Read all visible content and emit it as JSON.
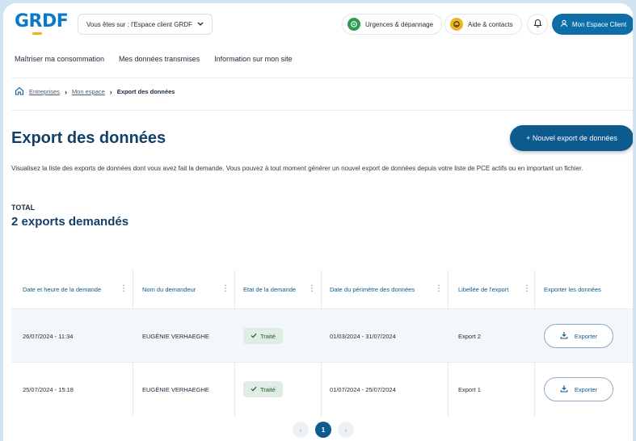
{
  "header": {
    "logo_text": "GRDF",
    "space_selector": "Vous êtes sur : l'Espace client GRDF",
    "urgences": "Urgences & dépannage",
    "aide": "Aide & contacts",
    "account": "Mon Espace Client"
  },
  "nav": {
    "items": [
      "Maîtriser ma consommation",
      "Mes données transmises",
      "Information sur mon site"
    ]
  },
  "breadcrumb": {
    "items": [
      "Entreprises",
      "Mon espace"
    ],
    "current": "Export des données"
  },
  "page": {
    "title": "Export des données",
    "new_button": "+ Nouvel export de données",
    "description": "Visualisez la liste des exports de données dont vous avez fait la demande. Vous pouvez à tout moment générer un nouvel export de données depuis votre liste de PCE actifs ou en important un fichier.",
    "total_label": "TOTAL",
    "total_value": "2 exports demandés"
  },
  "table": {
    "columns": [
      "Date et heure de la demande",
      "Nom du demandeur",
      "Etat de la demande",
      "Date du périmètre des données",
      "Libellée de l'export",
      "Exporter les données"
    ],
    "rows": [
      {
        "datetime": "26/07/2024 - 11:34",
        "name": "EUGÉNIE VERHAEGHE",
        "status": "Traité",
        "period": "01/03/2024 - 31/07/2024",
        "label": "Export 2",
        "action": "Exporter"
      },
      {
        "datetime": "25/07/2024 - 15:18",
        "name": "EUGÉNIE VERHAEGHE",
        "status": "Traité",
        "period": "01/07/2024 - 25/07/2024",
        "label": "Export 1",
        "action": "Exporter"
      }
    ]
  },
  "pagination": {
    "current_page": "1"
  },
  "colors": {
    "primary": "#0d5a8f",
    "title": "#13406a",
    "status_bg": "#e0ece4",
    "urgence": "#2e9b53",
    "aide": "#f2b316"
  }
}
